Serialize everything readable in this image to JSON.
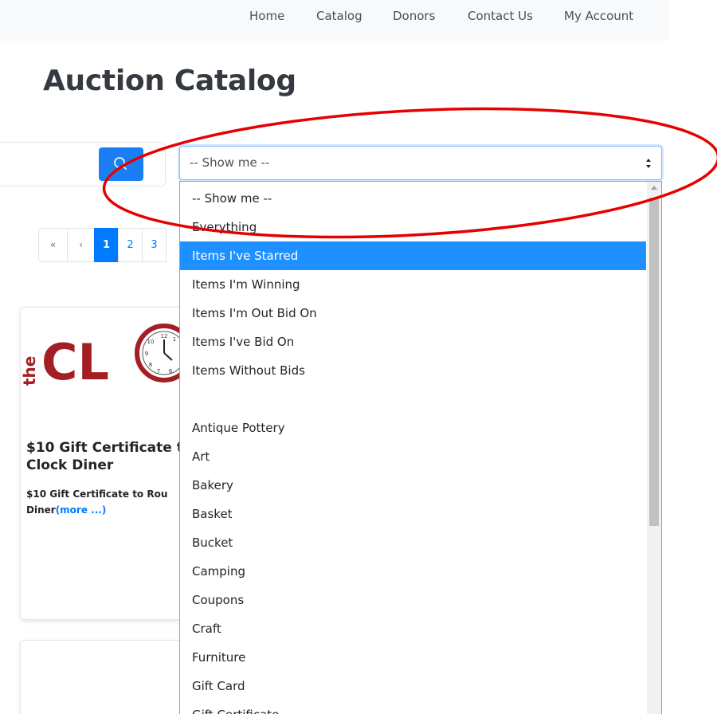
{
  "nav": {
    "items": [
      "Home",
      "Catalog",
      "Donors",
      "Contact Us",
      "My Account"
    ]
  },
  "page": {
    "title": "Auction Catalog"
  },
  "search": {
    "value": ""
  },
  "filter": {
    "selected": "-- Show me --",
    "options": [
      "-- Show me --",
      "Everything",
      "Items I've Starred",
      "Items I'm Winning",
      "Items I'm Out Bid On",
      "Items I've Bid On",
      "Items Without Bids",
      "",
      "Antique Pottery",
      "Art",
      "Bakery",
      "Basket",
      "Bucket",
      "Camping",
      "Coupons",
      "Craft",
      "Furniture",
      "Gift Card",
      "Gift Certificate"
    ],
    "highlighted": "Items I've Starred"
  },
  "pagination": {
    "first": "«",
    "prev": "‹",
    "pages": [
      "1",
      "2",
      "3"
    ],
    "current": "1"
  },
  "card": {
    "logo_text": "CL",
    "logo_small": "the",
    "title": "$10 Gift Certificate t Clock Diner",
    "title_line1": "$10 Gift Certificate t",
    "title_line2": "Clock Diner",
    "desc_line1": "$10 Gift Certificate to Rou",
    "desc_line2": "Diner",
    "more": "(more ...)"
  },
  "colors": {
    "accent": "#007bff",
    "highlight": "#1e90ff",
    "annotation": "#e60000",
    "logo": "#a31f24"
  }
}
